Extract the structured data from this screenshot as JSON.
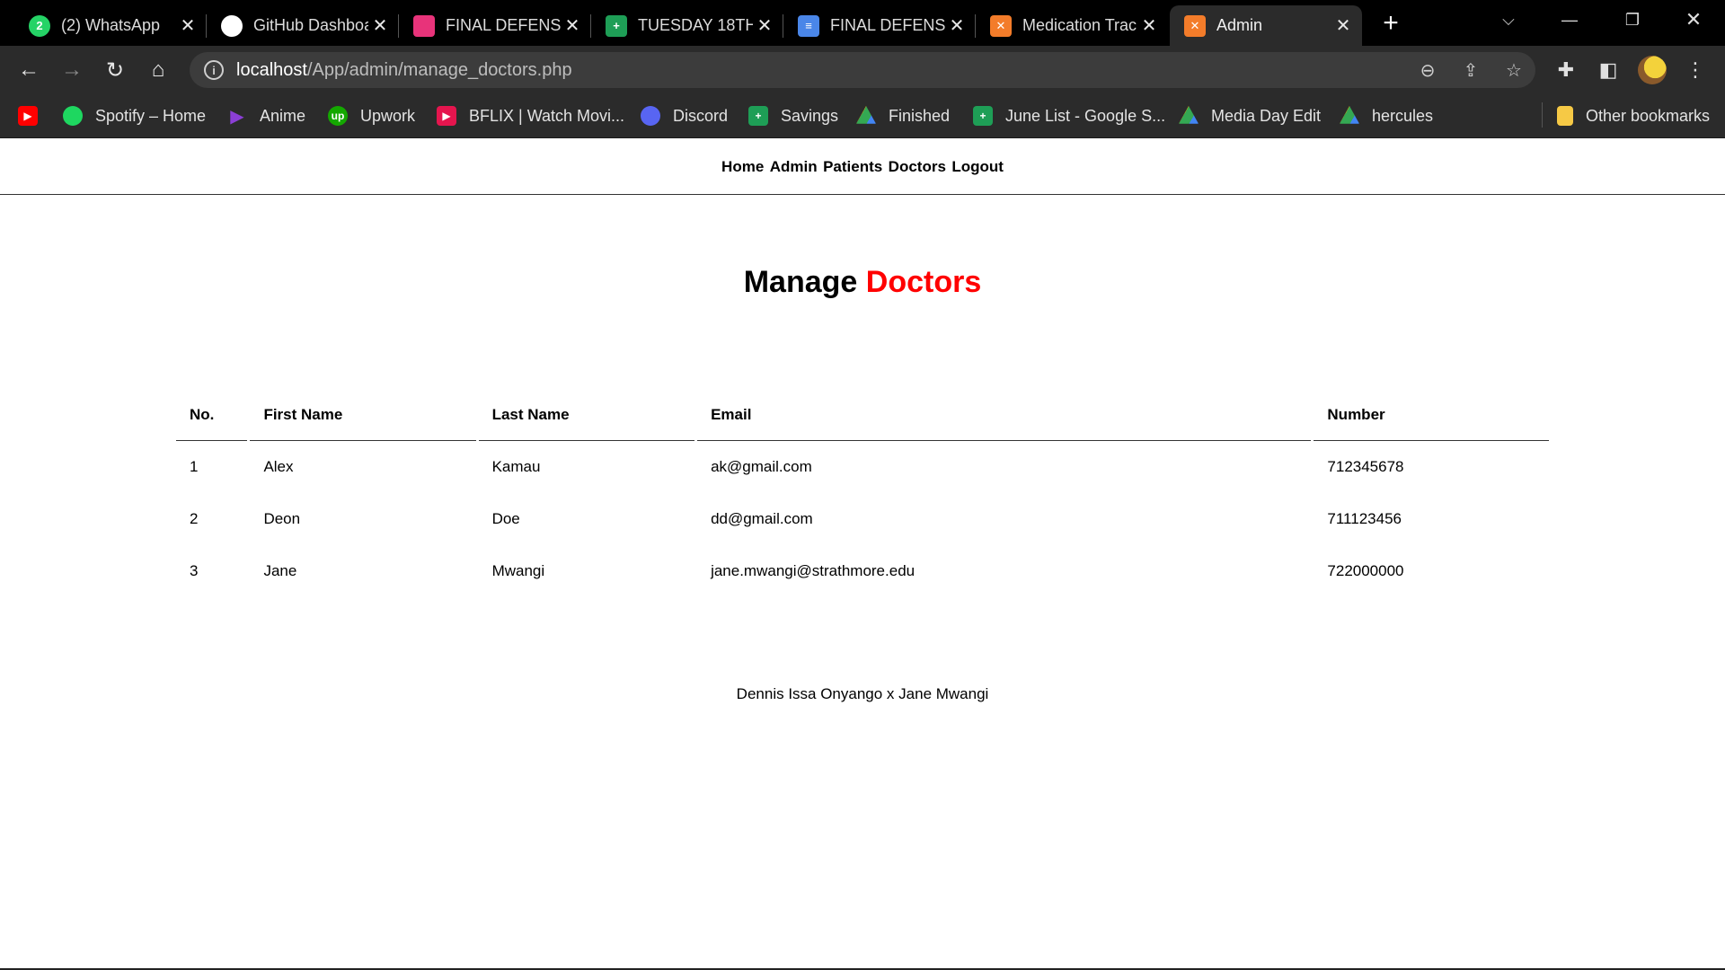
{
  "browser": {
    "tabs": [
      {
        "title": "(2) WhatsApp",
        "icon": "whatsapp-icon",
        "color": "#25d366",
        "glyph": "2"
      },
      {
        "title": "GitHub Dashboard",
        "icon": "github-icon",
        "color": "#ffffff",
        "glyph": ""
      },
      {
        "title": "FINAL DEFENSE",
        "icon": "google-classroom-icon",
        "color": "#e8337a",
        "glyph": ""
      },
      {
        "title": "TUESDAY 18TH",
        "icon": "google-sheets-icon",
        "color": "#1e9e56",
        "glyph": "+"
      },
      {
        "title": "FINAL DEFENSE",
        "icon": "google-docs-icon",
        "color": "#4a86e8",
        "glyph": "≡"
      },
      {
        "title": "Medication Tracker",
        "icon": "xampp-icon",
        "color": "#f37c2a",
        "glyph": "✕"
      },
      {
        "title": "Admin",
        "icon": "xampp-icon",
        "color": "#f37c2a",
        "glyph": "✕",
        "active": true
      }
    ],
    "url_host": "localhost",
    "url_path": "/App/admin/manage_doctors.php",
    "bookmarks": [
      {
        "label": "",
        "icon": "youtube-icon",
        "color": "#ff0000"
      },
      {
        "label": "Spotify – Home",
        "icon": "spotify-icon",
        "color": "#1ed760"
      },
      {
        "label": "Anime",
        "icon": "play-icon",
        "color": "#8b3fd6"
      },
      {
        "label": "Upwork",
        "icon": "upwork-icon",
        "color": "#14a800"
      },
      {
        "label": "BFLIX | Watch Movi...",
        "icon": "bflix-icon",
        "color": "#e5154e"
      },
      {
        "label": "Discord",
        "icon": "discord-icon",
        "color": "#5865f2"
      },
      {
        "label": "Savings",
        "icon": "google-sheets-icon",
        "color": "#1e9e56"
      },
      {
        "label": "Finished",
        "icon": "google-drive-icon",
        "color": "#fbbc04"
      },
      {
        "label": "June List - Google S...",
        "icon": "google-sheets-icon",
        "color": "#1e9e56"
      },
      {
        "label": "Media Day Edit",
        "icon": "google-drive-icon",
        "color": "#fbbc04"
      },
      {
        "label": "hercules",
        "icon": "google-drive-icon",
        "color": "#4285f4"
      }
    ],
    "other_bookmarks": "Other bookmarks"
  },
  "nav": {
    "items": [
      "Home",
      "Admin",
      "Patients",
      "Doctors",
      "Logout"
    ]
  },
  "page": {
    "title_prefix": "Manage",
    "title_accent": "Doctors",
    "accent_color": "#ff0000"
  },
  "table": {
    "headers": [
      "No.",
      "First Name",
      "Last Name",
      "Email",
      "Number"
    ],
    "rows": [
      [
        "1",
        "Alex",
        "Kamau",
        "ak@gmail.com",
        "712345678"
      ],
      [
        "2",
        "Deon",
        "Doe",
        "dd@gmail.com",
        "711123456"
      ],
      [
        "3",
        "Jane",
        "Mwangi",
        "jane.mwangi@strathmore.edu",
        "722000000"
      ]
    ]
  },
  "footer": {
    "text": "Dennis Issa Onyango x Jane Mwangi"
  }
}
